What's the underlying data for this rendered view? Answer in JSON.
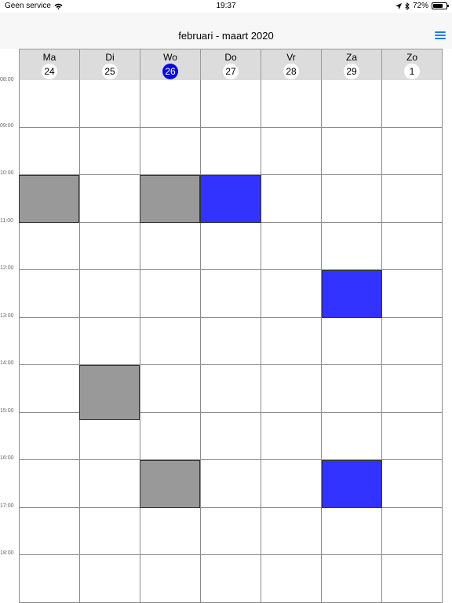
{
  "status_bar": {
    "carrier": "Geen service",
    "time": "19:37",
    "battery_text": "72%",
    "battery_level": 0.72
  },
  "nav": {
    "title": "februari - maart 2020"
  },
  "days": [
    {
      "name": "Ma",
      "num": "24",
      "today": false
    },
    {
      "name": "Di",
      "num": "25",
      "today": false
    },
    {
      "name": "Wo",
      "num": "26",
      "today": true
    },
    {
      "name": "Do",
      "num": "27",
      "today": false
    },
    {
      "name": "Vr",
      "num": "28",
      "today": false
    },
    {
      "name": "Za",
      "num": "29",
      "today": false
    },
    {
      "name": "Zo",
      "num": "1",
      "today": false
    }
  ],
  "hours": [
    "08:00",
    "09:00",
    "10:00",
    "11:00",
    "12:00",
    "13:00",
    "14:00",
    "15:00",
    "16:00",
    "17:00",
    "18:00"
  ],
  "colors": {
    "accent": "#1e7cf2",
    "today": "#0a0ad6",
    "event_blue": "#3333ff",
    "event_gray": "#999999"
  },
  "events": [
    {
      "day": 0,
      "start": 10.0,
      "end": 11.0,
      "kind": "gray"
    },
    {
      "day": 2,
      "start": 10.0,
      "end": 11.0,
      "kind": "gray"
    },
    {
      "day": 3,
      "start": 10.0,
      "end": 11.0,
      "kind": "blue"
    },
    {
      "day": 5,
      "start": 12.0,
      "end": 13.0,
      "kind": "blue"
    },
    {
      "day": 1,
      "start": 14.0,
      "end": 15.15,
      "kind": "gray"
    },
    {
      "day": 2,
      "start": 16.0,
      "end": 17.0,
      "kind": "gray"
    },
    {
      "day": 5,
      "start": 16.0,
      "end": 17.0,
      "kind": "blue"
    }
  ]
}
